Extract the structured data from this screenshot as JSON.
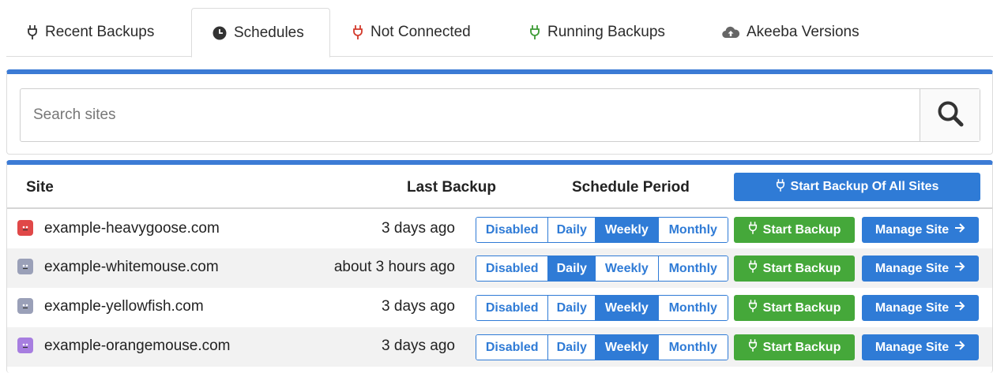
{
  "tabs": [
    {
      "label": "Recent Backups",
      "icon": "plug-icon",
      "icon_color": "#333333"
    },
    {
      "label": "Schedules",
      "icon": "clock-icon",
      "icon_color": "#333333",
      "active": true
    },
    {
      "label": "Not Connected",
      "icon": "plug-icon",
      "icon_color": "#d33a2c"
    },
    {
      "label": "Running Backups",
      "icon": "plug-icon",
      "icon_color": "#3d9b35"
    },
    {
      "label": "Akeeba Versions",
      "icon": "cloud-upload-icon",
      "icon_color": "#666666"
    }
  ],
  "search": {
    "placeholder": "Search sites",
    "value": ""
  },
  "table": {
    "headers": {
      "site": "Site",
      "last_backup": "Last Backup",
      "schedule_period": "Schedule Period"
    },
    "start_all_label": "Start Backup Of All Sites",
    "period_labels": [
      "Disabled",
      "Daily",
      "Weekly",
      "Monthly"
    ],
    "start_label": "Start Backup",
    "manage_label": "Manage Site",
    "rows": [
      {
        "site": "example-heavygoose.com",
        "last_backup": "3 days ago",
        "schedule": "Weekly",
        "icon_color": "#e04848"
      },
      {
        "site": "example-whitemouse.com",
        "last_backup": "about 3 hours ago",
        "schedule": "Daily",
        "icon_color": "#9aa0b8"
      },
      {
        "site": "example-yellowfish.com",
        "last_backup": "3 days ago",
        "schedule": "Weekly",
        "icon_color": "#9aa0b8"
      },
      {
        "site": "example-orangemouse.com",
        "last_backup": "3 days ago",
        "schedule": "Weekly",
        "icon_color": "#a77ee0"
      }
    ]
  },
  "colors": {
    "accent": "#2f7bd6",
    "success": "#45a83a",
    "panel_top": "#3c7bd5"
  }
}
